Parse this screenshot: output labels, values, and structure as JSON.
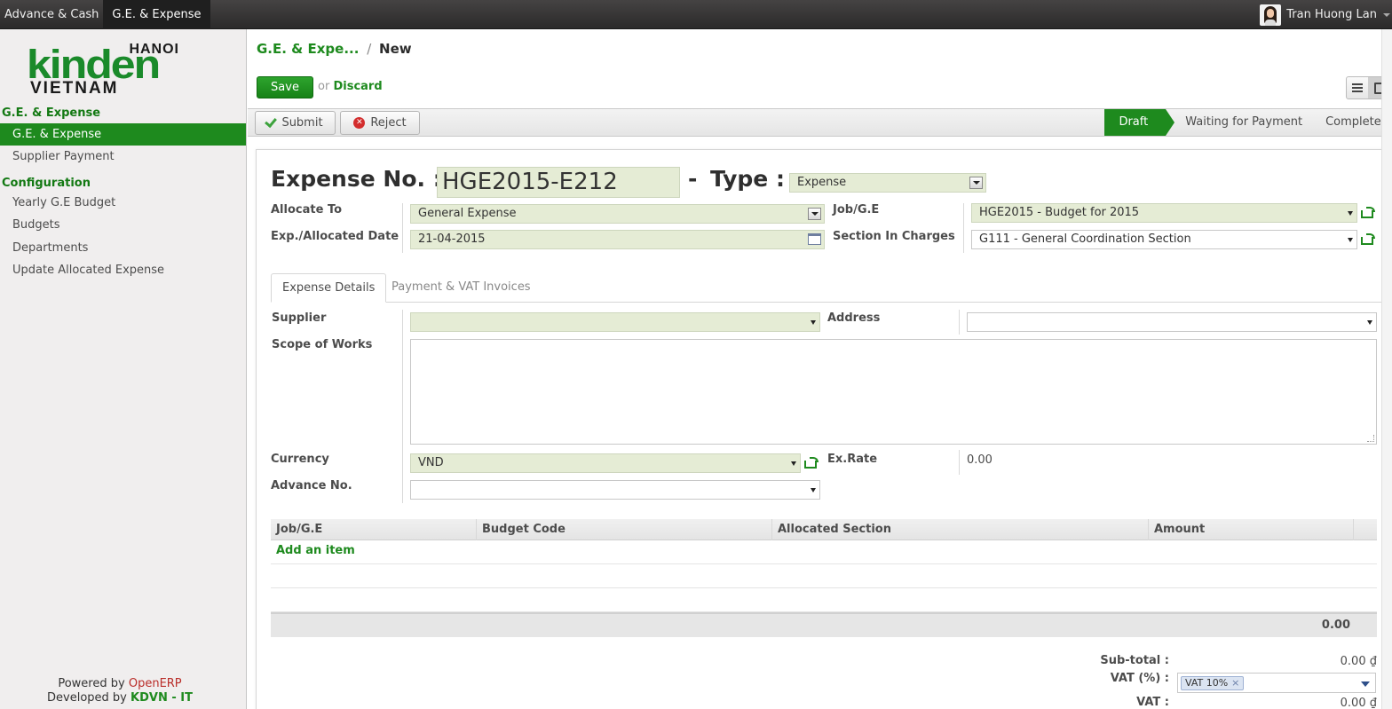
{
  "topbar": {
    "menu": [
      "Advance & Cash",
      "G.E. & Expense"
    ],
    "user_name": "Tran Huong Lan"
  },
  "logo": {
    "city": "HANOI",
    "brand": "kinden",
    "country": "VIETNAM"
  },
  "sidebar": {
    "section1": "G.E. & Expense",
    "items1": [
      "G.E. & Expense",
      "Supplier Payment"
    ],
    "section2": "Configuration",
    "items2": [
      "Yearly G.E Budget",
      "Budgets",
      "Departments",
      "Update Allocated Expense"
    ],
    "footer": {
      "powered_prefix": "Powered by",
      "powered_name": "OpenERP",
      "developed_prefix": "Developed by",
      "developed_name": "KDVN - IT"
    }
  },
  "breadcrumb": {
    "parent": "G.E. & Expe...",
    "separator": "/",
    "current": "New"
  },
  "actions": {
    "save": "Save",
    "or": "or",
    "discard": "Discard"
  },
  "statusbar": {
    "submit": "Submit",
    "reject": "Reject",
    "stages": [
      "Draft",
      "Waiting for Payment",
      "Completed"
    ],
    "current_stage": "Draft"
  },
  "form": {
    "expense_no_label": "Expense No. :",
    "expense_no_value": "HGE2015-E212",
    "dash": "-",
    "type_label": "Type :",
    "type_value": "Expense",
    "allocate_to_label": "Allocate To",
    "allocate_to_value": "General Expense",
    "job_ge_label": "Job/G.E",
    "job_ge_value": "HGE2015 - Budget for 2015",
    "date_label": "Exp./Allocated Date",
    "date_value": "21-04-2015",
    "section_label": "Section In Charges",
    "section_value": "G111 - General Coordination Section"
  },
  "tabs": [
    "Expense Details",
    "Payment & VAT Invoices"
  ],
  "details": {
    "supplier_label": "Supplier",
    "supplier_value": "",
    "address_label": "Address",
    "address_value": "",
    "scope_label": "Scope of Works",
    "currency_label": "Currency",
    "currency_value": "VND",
    "exrate_label": "Ex.Rate",
    "exrate_value": "0.00",
    "advance_label": "Advance No.",
    "advance_value": ""
  },
  "grid": {
    "columns": [
      "Job/G.E",
      "Budget Code",
      "Allocated Section",
      "Amount"
    ],
    "add_item": "Add an item",
    "total": "0.00"
  },
  "totals": {
    "subtotal_label": "Sub-total :",
    "subtotal_value": "0.00 ₫",
    "vat_pct_label": "VAT (%) :",
    "vat_tag": "VAT 10%",
    "vat_tag_remove": "×",
    "vat_label": "VAT :",
    "vat_value": "0.00 ₫"
  },
  "colors": {
    "brand_green": "#1e8a1e",
    "field_bg": "#e5ecd5",
    "topbar": "#2b2a2a"
  }
}
